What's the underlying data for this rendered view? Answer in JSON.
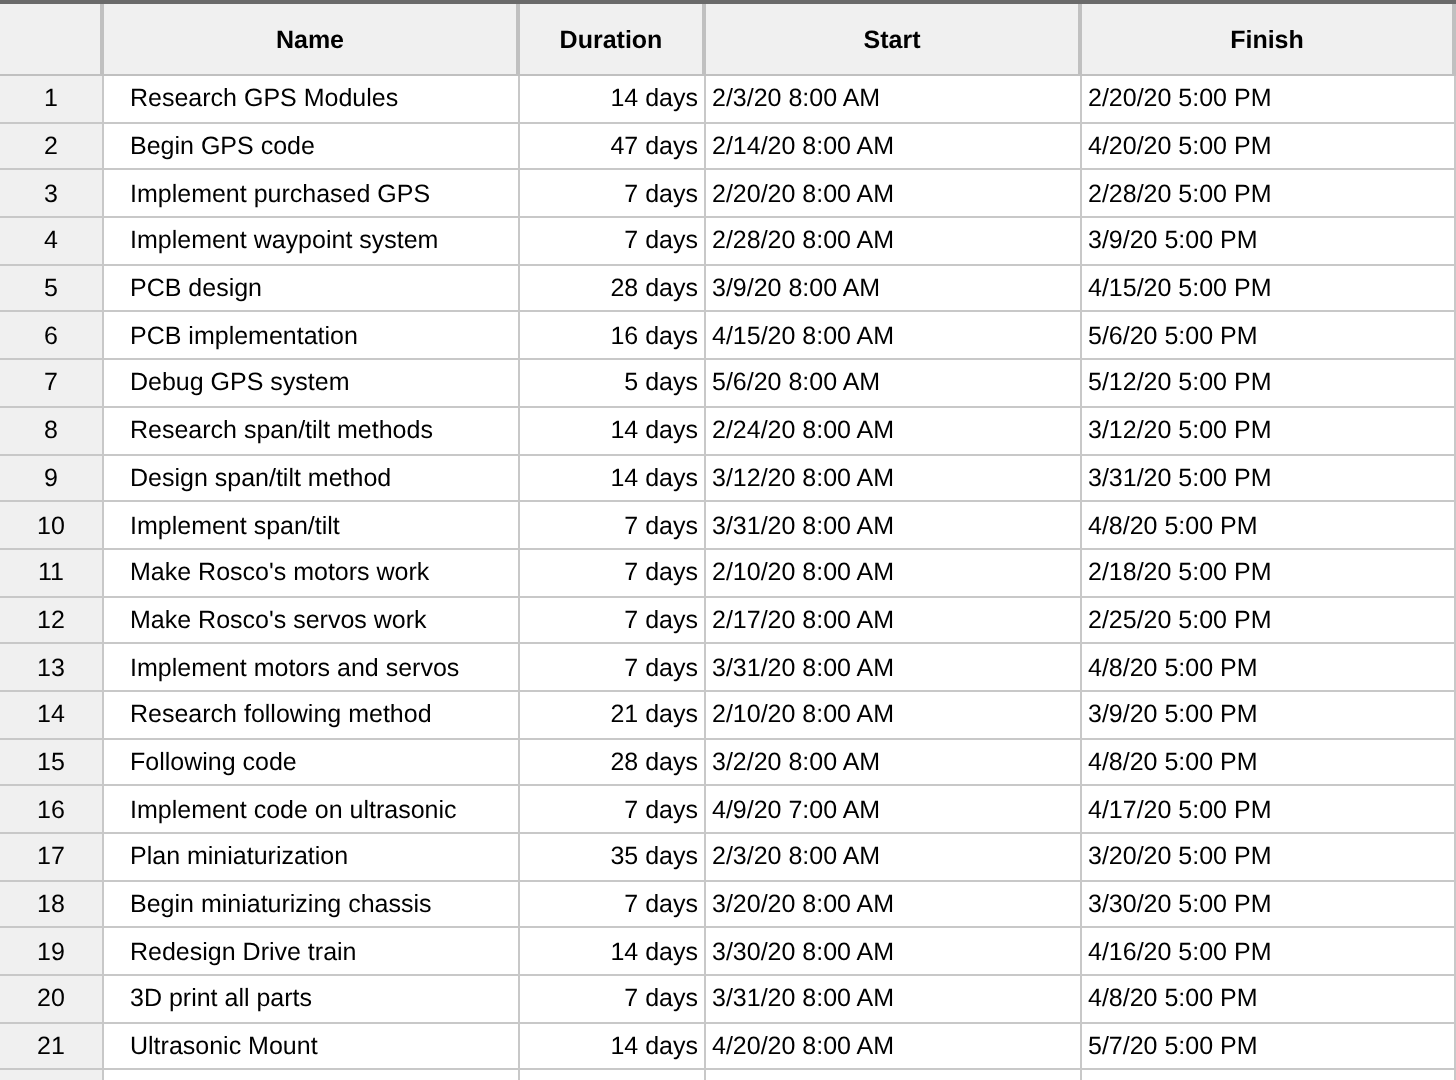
{
  "table": {
    "columns": [
      "",
      "Name",
      "Duration",
      "Start",
      "Finish"
    ],
    "rows": [
      [
        "1",
        "Research GPS Modules",
        "14 days",
        "2/3/20 8:00 AM",
        "2/20/20 5:00 PM"
      ],
      [
        "2",
        "Begin GPS code",
        "47 days",
        "2/14/20 8:00 AM",
        "4/20/20 5:00 PM"
      ],
      [
        "3",
        "Implement purchased GPS",
        "7 days",
        "2/20/20 8:00 AM",
        "2/28/20 5:00 PM"
      ],
      [
        "4",
        "Implement waypoint system",
        "7 days",
        "2/28/20 8:00 AM",
        "3/9/20 5:00 PM"
      ],
      [
        "5",
        "PCB design",
        "28 days",
        "3/9/20 8:00 AM",
        "4/15/20 5:00 PM"
      ],
      [
        "6",
        "PCB implementation",
        "16 days",
        "4/15/20 8:00 AM",
        "5/6/20 5:00 PM"
      ],
      [
        "7",
        "Debug GPS system",
        "5 days",
        "5/6/20 8:00 AM",
        "5/12/20 5:00 PM"
      ],
      [
        "8",
        "Research span/tilt methods",
        "14 days",
        "2/24/20 8:00 AM",
        "3/12/20 5:00 PM"
      ],
      [
        "9",
        "Design span/tilt method",
        "14 days",
        "3/12/20 8:00 AM",
        "3/31/20 5:00 PM"
      ],
      [
        "10",
        "Implement span/tilt",
        "7 days",
        "3/31/20 8:00 AM",
        "4/8/20 5:00 PM"
      ],
      [
        "11",
        "Make Rosco's motors work",
        "7 days",
        "2/10/20 8:00 AM",
        "2/18/20 5:00 PM"
      ],
      [
        "12",
        "Make Rosco's servos work",
        "7 days",
        "2/17/20 8:00 AM",
        "2/25/20 5:00 PM"
      ],
      [
        "13",
        "Implement motors and servos",
        "7 days",
        "3/31/20 8:00 AM",
        "4/8/20 5:00 PM"
      ],
      [
        "14",
        "Research following method",
        "21 days",
        "2/10/20 8:00 AM",
        "3/9/20 5:00 PM"
      ],
      [
        "15",
        "Following code",
        "28 days",
        "3/2/20 8:00 AM",
        "4/8/20 5:00 PM"
      ],
      [
        "16",
        "Implement code on ultrasonic",
        "7 days",
        "4/9/20 7:00 AM",
        "4/17/20 5:00 PM"
      ],
      [
        "17",
        "Plan miniaturization",
        "35 days",
        "2/3/20 8:00 AM",
        "3/20/20 5:00 PM"
      ],
      [
        "18",
        "Begin miniaturizing chassis",
        "7 days",
        "3/20/20 8:00 AM",
        "3/30/20 5:00 PM"
      ],
      [
        "19",
        "Redesign Drive train",
        "14 days",
        "3/30/20 8:00 AM",
        "4/16/20 5:00 PM"
      ],
      [
        "20",
        "3D print all parts",
        "7 days",
        "3/31/20 8:00 AM",
        "4/8/20 5:00 PM"
      ],
      [
        "21",
        "Ultrasonic Mount",
        "14 days",
        "4/20/20 8:00 AM",
        "5/7/20 5:00 PM"
      ]
    ]
  }
}
